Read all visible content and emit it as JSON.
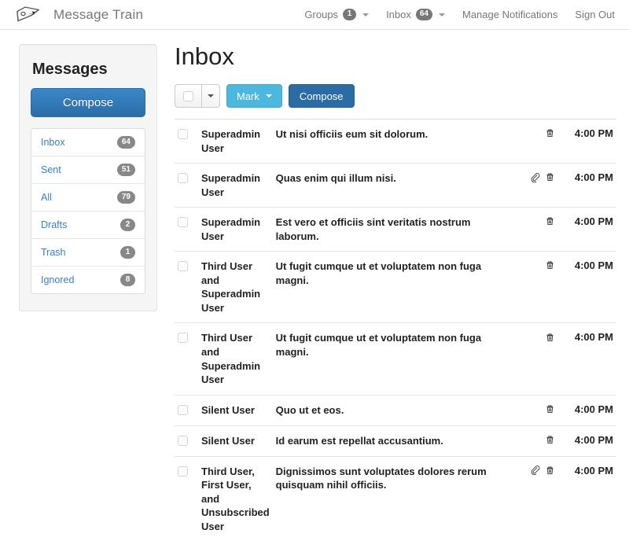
{
  "navbar": {
    "logo_icon": "mailbox-arrow-icon",
    "brand_title": "Message Train",
    "links": [
      {
        "label": "Groups",
        "badge": "1",
        "has_caret": true,
        "name": "groups"
      },
      {
        "label": "Inbox",
        "badge": "64",
        "has_caret": true,
        "name": "inbox"
      },
      {
        "label": "Manage Notifications",
        "badge": null,
        "has_caret": false,
        "name": "manage-notifications"
      },
      {
        "label": "Sign Out",
        "badge": null,
        "has_caret": false,
        "name": "sign-out"
      }
    ]
  },
  "sidebar": {
    "title": "Messages",
    "compose_label": "Compose",
    "folders": [
      {
        "label": "Inbox",
        "count": "64"
      },
      {
        "label": "Sent",
        "count": "51"
      },
      {
        "label": "All",
        "count": "79"
      },
      {
        "label": "Drafts",
        "count": "2"
      },
      {
        "label": "Trash",
        "count": "1"
      },
      {
        "label": "Ignored",
        "count": "8"
      }
    ]
  },
  "main": {
    "page_title": "Inbox",
    "toolbar": {
      "select_all_checkbox": "",
      "select_all_caret": "caret-down-icon",
      "mark_label": "Mark",
      "compose_label": "Compose"
    },
    "messages": [
      {
        "from": "Superadmin User",
        "subject": "Ut nisi officiis eum sit dolorum.",
        "attachment": false,
        "time": "4:00 PM"
      },
      {
        "from": "Superadmin User",
        "subject": "Quas enim qui illum nisi.",
        "attachment": true,
        "time": "4:00 PM"
      },
      {
        "from": "Superadmin User",
        "subject": "Est vero et officiis sint veritatis nostrum laborum.",
        "attachment": false,
        "time": "4:00 PM"
      },
      {
        "from": "Third User and Superadmin User",
        "subject": "Ut fugit cumque ut et voluptatem non fuga magni.",
        "attachment": false,
        "time": "4:00 PM"
      },
      {
        "from": "Third User and Superadmin User",
        "subject": "Ut fugit cumque ut et voluptatem non fuga magni.",
        "attachment": false,
        "time": "4:00 PM"
      },
      {
        "from": "Silent User",
        "subject": "Quo ut et eos.",
        "attachment": false,
        "time": "4:00 PM"
      },
      {
        "from": "Silent User",
        "subject": "Id earum est repellat accusantium.",
        "attachment": false,
        "time": "4:00 PM"
      },
      {
        "from": "Third User, First User, and Unsubscribed User",
        "subject": "Dignissimos sunt voluptates dolores rerum quisquam nihil officiis.",
        "attachment": true,
        "time": "4:00 PM"
      }
    ]
  },
  "colors": {
    "brand_blue": "#2b6ca5",
    "link_blue": "#3a80c4",
    "mark_blue": "#4cb8dd",
    "badge_gray": "#888888",
    "panel_gray": "#f5f5f5"
  }
}
